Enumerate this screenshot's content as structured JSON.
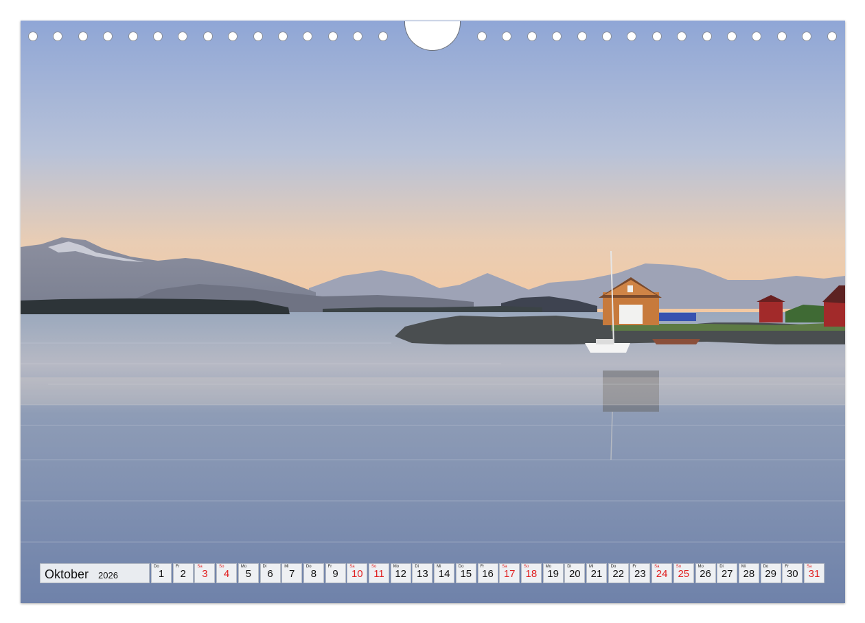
{
  "calendar": {
    "month": "Oktober",
    "year": "2026",
    "weekend_color": "#e02020",
    "days": [
      {
        "wd": "Do",
        "d": "1",
        "we": false
      },
      {
        "wd": "Fr",
        "d": "2",
        "we": false
      },
      {
        "wd": "Sa",
        "d": "3",
        "we": true
      },
      {
        "wd": "So",
        "d": "4",
        "we": true
      },
      {
        "wd": "Mo",
        "d": "5",
        "we": false
      },
      {
        "wd": "Di",
        "d": "6",
        "we": false
      },
      {
        "wd": "Mi",
        "d": "7",
        "we": false
      },
      {
        "wd": "Do",
        "d": "8",
        "we": false
      },
      {
        "wd": "Fr",
        "d": "9",
        "we": false
      },
      {
        "wd": "Sa",
        "d": "10",
        "we": true
      },
      {
        "wd": "So",
        "d": "11",
        "we": true
      },
      {
        "wd": "Mo",
        "d": "12",
        "we": false
      },
      {
        "wd": "Di",
        "d": "13",
        "we": false
      },
      {
        "wd": "Mi",
        "d": "14",
        "we": false
      },
      {
        "wd": "Do",
        "d": "15",
        "we": false
      },
      {
        "wd": "Fr",
        "d": "16",
        "we": false
      },
      {
        "wd": "Sa",
        "d": "17",
        "we": true
      },
      {
        "wd": "So",
        "d": "18",
        "we": true
      },
      {
        "wd": "Mo",
        "d": "19",
        "we": false
      },
      {
        "wd": "Di",
        "d": "20",
        "we": false
      },
      {
        "wd": "Mi",
        "d": "21",
        "we": false
      },
      {
        "wd": "Do",
        "d": "22",
        "we": false
      },
      {
        "wd": "Fr",
        "d": "23",
        "we": false
      },
      {
        "wd": "Sa",
        "d": "24",
        "we": true
      },
      {
        "wd": "So",
        "d": "25",
        "we": true
      },
      {
        "wd": "Mo",
        "d": "26",
        "we": false
      },
      {
        "wd": "Di",
        "d": "27",
        "we": false
      },
      {
        "wd": "Mi",
        "d": "28",
        "we": false
      },
      {
        "wd": "Do",
        "d": "29",
        "we": false
      },
      {
        "wd": "Fr",
        "d": "30",
        "we": false
      },
      {
        "wd": "Sa",
        "d": "31",
        "we": true
      }
    ]
  }
}
